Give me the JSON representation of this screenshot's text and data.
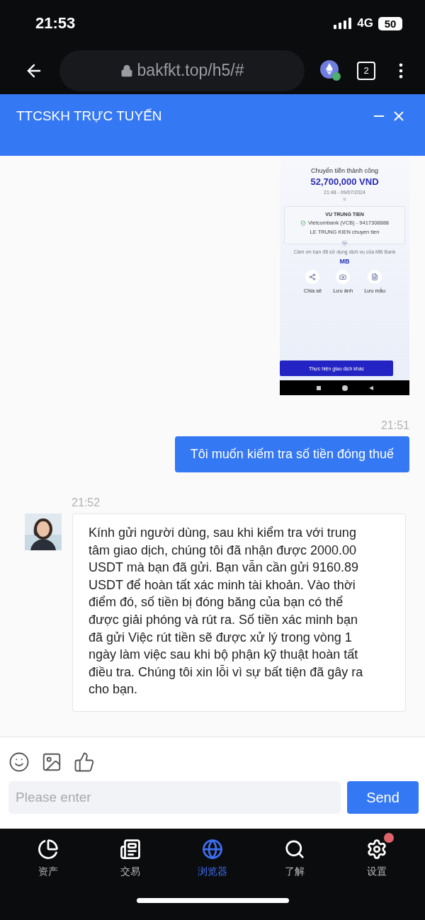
{
  "status_bar": {
    "time": "21:53",
    "network": "4G",
    "battery": "50"
  },
  "browser": {
    "url": "bakfkt.top/h5/#",
    "tab_count": "2"
  },
  "chat_header": {
    "title": "TTCSKH TRỰC TUYẾN"
  },
  "messages": [
    {
      "kind": "image",
      "receipt": {
        "title": "Chuyển tiền thành công",
        "amount": "52,700,000 VND",
        "datetime": "21:48 - 09/07/2024",
        "recipient": "VU TRUNG TIEN",
        "bank": "Vietcombank (VCB) - 9417308888",
        "note": "LE TRUNG KIEN chuyen tien",
        "thanks": "Cảm ơn bạn đã sử dụng dịch vụ của MB Bank",
        "brand": "MB",
        "actions": [
          {
            "kind": "share",
            "label": "Chia sẻ"
          },
          {
            "kind": "camera",
            "label": "Lưu ảnh"
          },
          {
            "kind": "template",
            "label": "Lưu mẫu"
          }
        ],
        "button": "Thực hiện giao dịch khác"
      }
    },
    {
      "kind": "sent",
      "time": "21:51",
      "text": "Tôi muốn kiếm tra số tiền đóng thuế"
    },
    {
      "kind": "received",
      "time": "21:52",
      "text": "Kính gửi người dùng, sau khi kiểm tra với trung tâm giao dịch, chúng tôi đã nhận được 2000.00 USDT mà bạn đã gửi. Bạn vẫn cần gửi 9160.89 USDT để hoàn tất xác minh tài khoản. Vào thời điểm đó, số tiền bị đóng băng của bạn có thể được giải phóng và rút ra. Số tiền xác minh bạn đã gửi Việc rút tiền sẽ được xử lý trong vòng 1 ngày làm việc sau khi bộ phận kỹ thuật hoàn tất điều tra. Chúng tôi xin lỗi vì sự bất tiện đã gây ra cho bạn."
    }
  ],
  "composer": {
    "placeholder": "Please enter",
    "send": "Send"
  },
  "tabs": [
    {
      "kind": "assets",
      "label": "资产",
      "selected": false,
      "badge": false
    },
    {
      "kind": "trade",
      "label": "交易",
      "selected": false,
      "badge": false
    },
    {
      "kind": "browser",
      "label": "浏览器",
      "selected": true,
      "badge": false
    },
    {
      "kind": "learn",
      "label": "了解",
      "selected": false,
      "badge": false
    },
    {
      "kind": "settings",
      "label": "设置",
      "selected": false,
      "badge": true
    }
  ]
}
